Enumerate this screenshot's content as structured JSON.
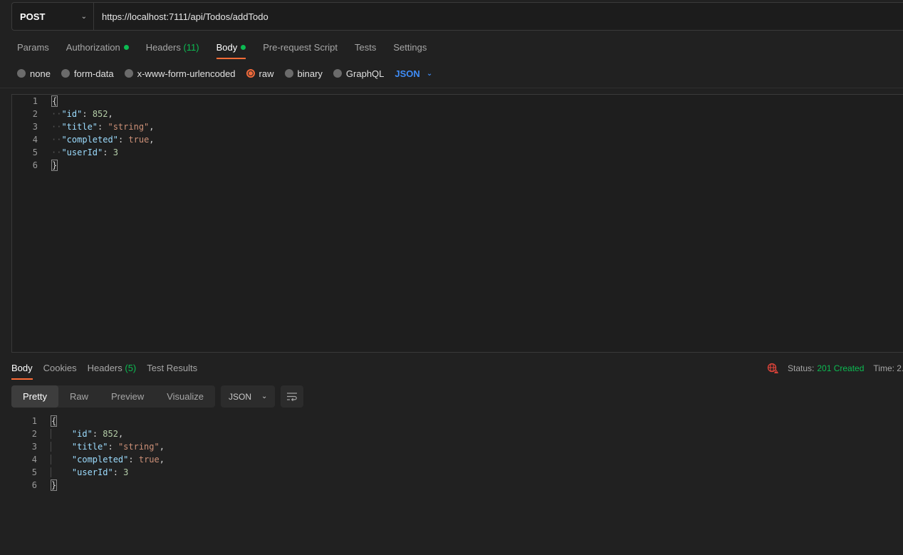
{
  "request": {
    "method": "POST",
    "url": "https://localhost:7111/api/Todos/addTodo",
    "tabs": [
      {
        "label": "Params"
      },
      {
        "label": "Authorization"
      },
      {
        "label": "Headers",
        "count": "(11)"
      },
      {
        "label": "Body"
      },
      {
        "label": "Pre-request Script"
      },
      {
        "label": "Tests"
      },
      {
        "label": "Settings"
      }
    ],
    "body_types": [
      "none",
      "form-data",
      "x-www-form-urlencoded",
      "raw",
      "binary",
      "GraphQL"
    ],
    "selected_body_type": "raw",
    "format": "JSON",
    "line_numbers": [
      "1",
      "2",
      "3",
      "4",
      "5",
      "6"
    ],
    "body": {
      "id": "852",
      "title": "\"string\"",
      "completed": "true",
      "userId": "3"
    }
  },
  "response": {
    "tabs": [
      {
        "label": "Body"
      },
      {
        "label": "Cookies"
      },
      {
        "label": "Headers",
        "count": "(5)"
      },
      {
        "label": "Test Results"
      }
    ],
    "status_label": "Status:",
    "status_value": "201 Created",
    "time_label": "Time: 2.",
    "views": [
      "Pretty",
      "Raw",
      "Preview",
      "Visualize"
    ],
    "format": "JSON",
    "line_numbers": [
      "1",
      "2",
      "3",
      "4",
      "5",
      "6"
    ],
    "body": {
      "id": "852",
      "title": "\"string\"",
      "completed": "true",
      "userId": "3"
    }
  },
  "colors": {
    "accent": "#ff6c37",
    "success": "#0cbb52",
    "link": "#3f8cf6"
  }
}
